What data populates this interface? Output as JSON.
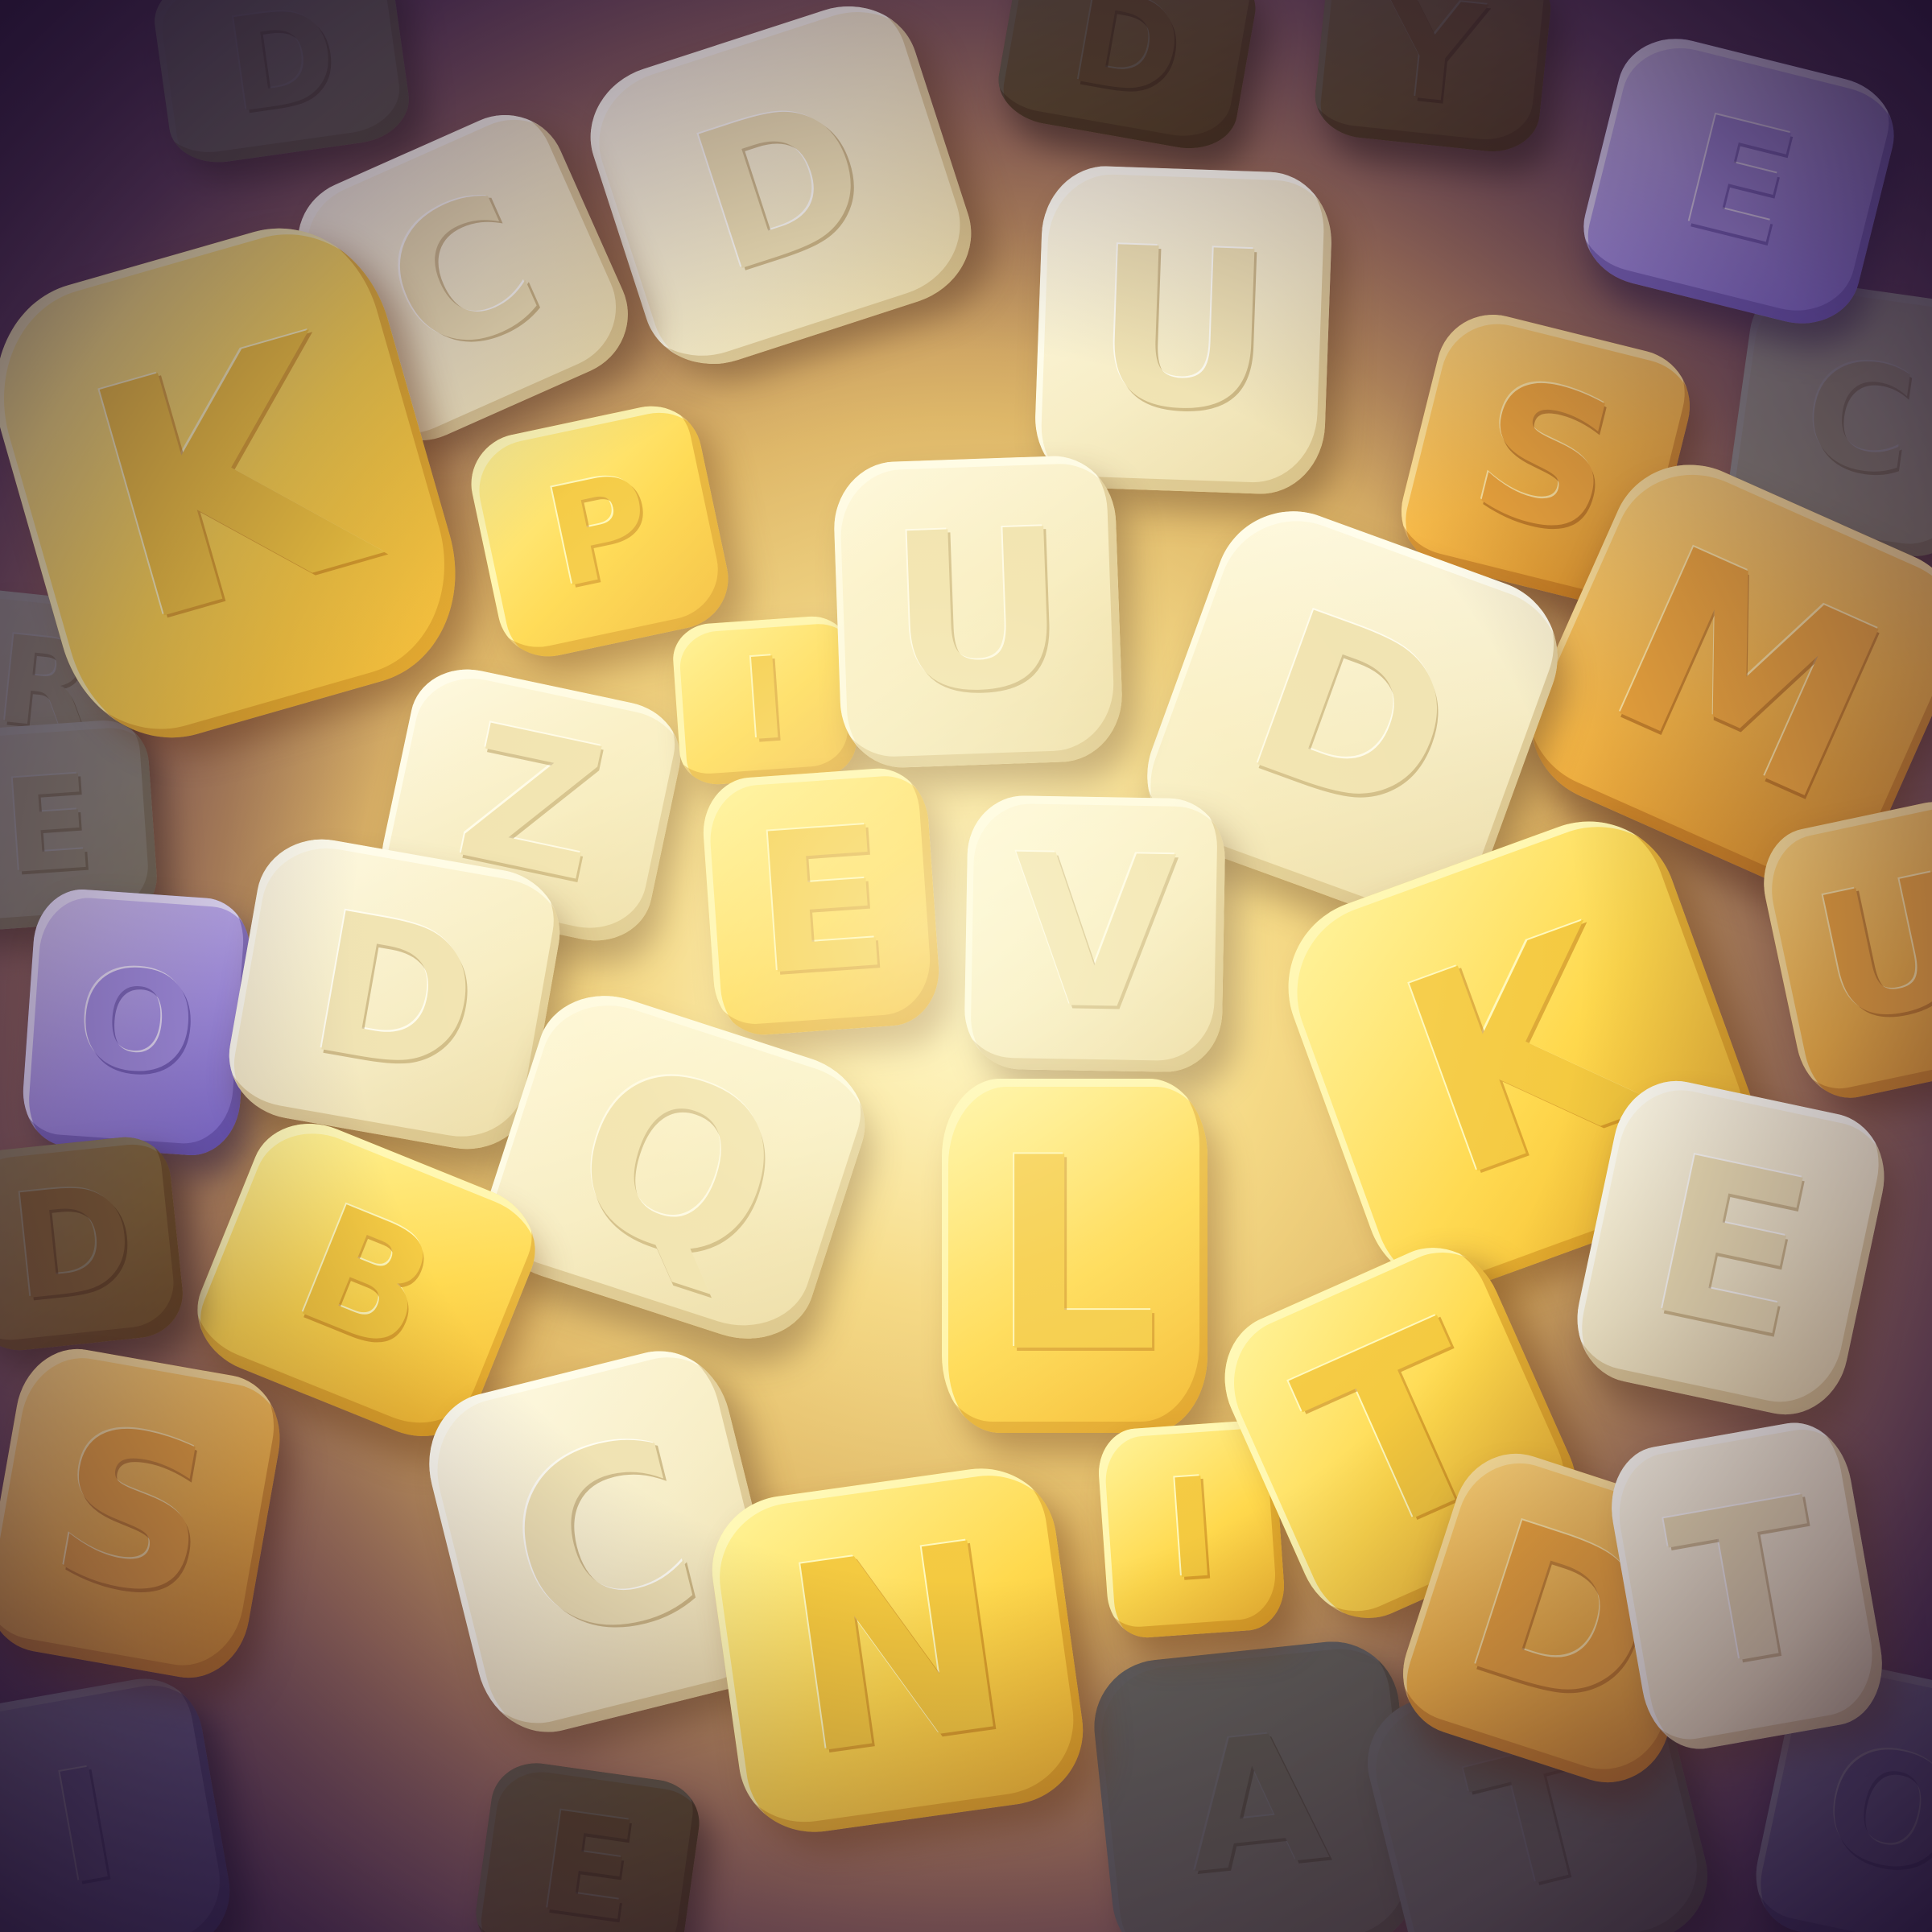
{
  "scene": {
    "description_colors": {
      "background_center": "#fff3b8",
      "background_edge": "#33213f",
      "cream_block": "#f6edc9",
      "yellow_block": "#ffd84a",
      "amber_block": "#f7b743",
      "lavender_block": "#a996e8"
    },
    "letters": [
      {
        "char": "U"
      },
      {
        "char": "U"
      },
      {
        "char": "E"
      },
      {
        "char": "V"
      },
      {
        "char": "K"
      },
      {
        "char": "K"
      },
      {
        "char": "S"
      },
      {
        "char": "C"
      },
      {
        "char": "E"
      },
      {
        "char": "T"
      },
      {
        "char": "N"
      },
      {
        "char": "D"
      },
      {
        "char": "D"
      },
      {
        "char": "Z"
      },
      {
        "char": "L"
      },
      {
        "char": "C"
      },
      {
        "char": "D"
      },
      {
        "char": "Q"
      },
      {
        "char": "E"
      },
      {
        "char": "M"
      },
      {
        "char": "T"
      },
      {
        "char": "O"
      },
      {
        "char": "I"
      },
      {
        "char": "U"
      },
      {
        "char": "S"
      },
      {
        "char": "P"
      },
      {
        "char": "I"
      },
      {
        "char": "B"
      },
      {
        "char": "D"
      },
      {
        "char": "R"
      },
      {
        "char": "E"
      },
      {
        "char": "C"
      },
      {
        "char": "A"
      },
      {
        "char": "T"
      },
      {
        "char": "D"
      },
      {
        "char": "D"
      },
      {
        "char": "Y"
      },
      {
        "char": "E"
      },
      {
        "char": "O"
      }
    ]
  }
}
